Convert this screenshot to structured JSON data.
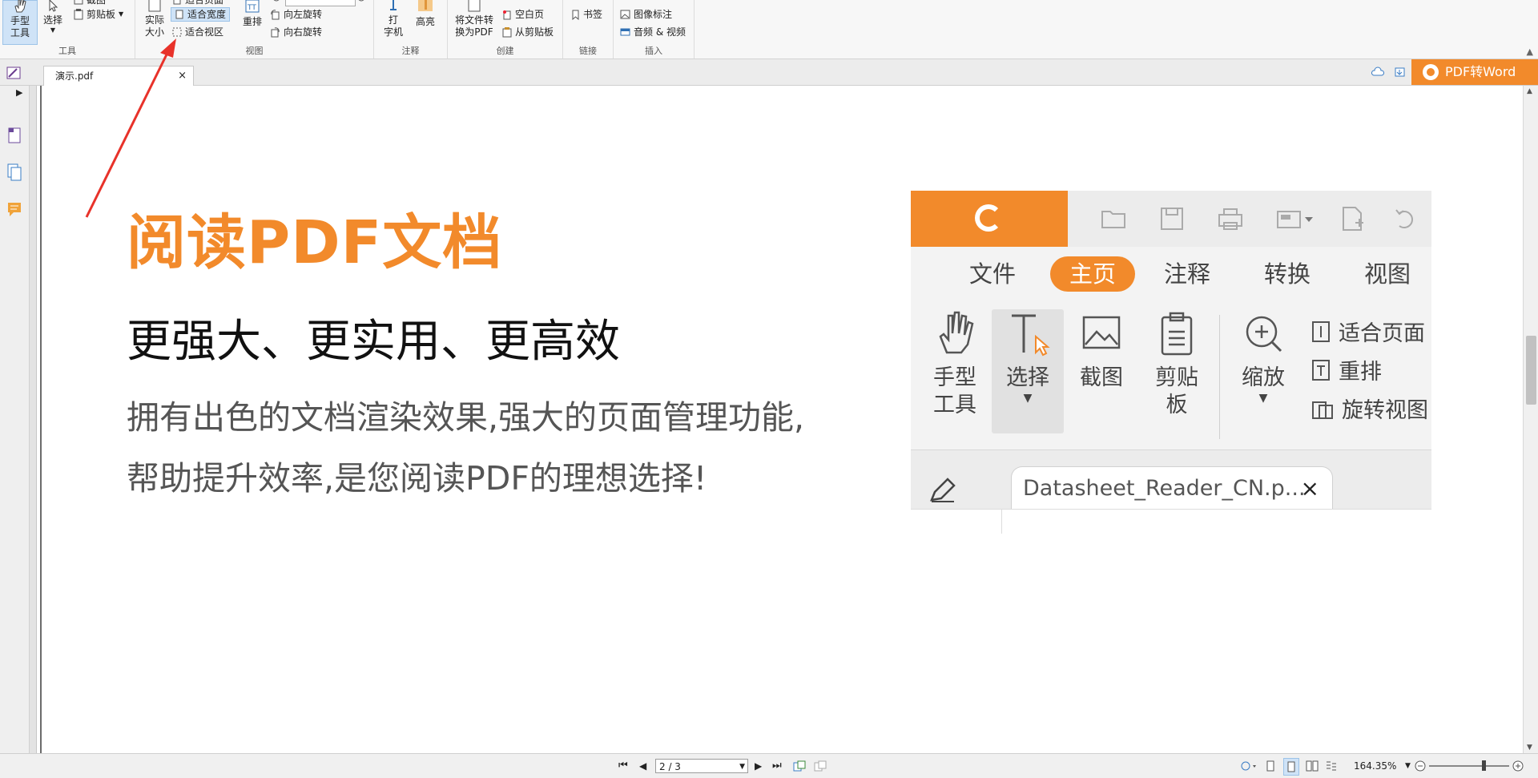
{
  "ribbon": {
    "tools": {
      "hand_tool": "手型\n工具",
      "select": "选择",
      "snapshot": "截图",
      "clipboard": "剪贴板",
      "group_label": "工具"
    },
    "view": {
      "actual_size": "实际\n大小",
      "fit_page": "适合页面",
      "fit_width": "适合宽度",
      "fit_visible": "适合视区",
      "reflow": "重排",
      "rotate_left": "向左旋转",
      "rotate_right": "向右旋转",
      "group_label": "视图"
    },
    "comment": {
      "typewriter": "打\n字机",
      "highlight": "高亮",
      "group_label": "注释"
    },
    "create": {
      "convert": "将文件转\n换为PDF",
      "blank": "空白页",
      "from_clipboard": "从剪贴板",
      "group_label": "创建"
    },
    "links": {
      "bookmark": "书签",
      "group_label": "链接"
    },
    "insert": {
      "image_annotation": "图像标注",
      "audio_video": "音频 & 视频",
      "group_label": "插入"
    }
  },
  "tabs": {
    "document_tab": "演示.pdf",
    "close": "×",
    "pdf_to_word": "PDF转Word"
  },
  "page": {
    "headline": "阅读PDF文档",
    "subline": "更强大、更实用、更高效",
    "body_line1": "拥有出色的文档渲染效果,强大的页面管理功能,",
    "body_line2": "帮助提升效率,是您阅读PDF的理想选择!"
  },
  "embedded_screenshot": {
    "tabs": [
      "文件",
      "主页",
      "注释",
      "转换",
      "视图"
    ],
    "active_tab": "主页",
    "tools": {
      "hand": "手型\n工具",
      "select": "选择",
      "snapshot": "截图",
      "clipboard": "剪贴\n板",
      "zoom": "缩放"
    },
    "side_items": [
      "适合页面",
      "重排",
      "旋转视图"
    ],
    "doc_tab": "Datasheet_Reader_CN.p...",
    "doc_tab_close": "×"
  },
  "statusbar": {
    "page_indicator": "2 / 3",
    "zoom_level": "164.35%"
  },
  "colors": {
    "accent": "#f28a2b",
    "annotation_arrow": "#e8322a"
  }
}
